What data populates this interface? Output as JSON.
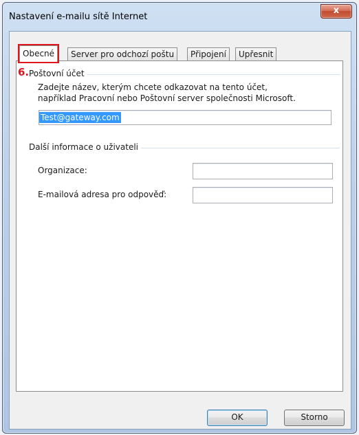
{
  "window": {
    "title": "Nastavení e-mailu sítě Internet",
    "close_glyph": "x"
  },
  "tabs": [
    {
      "label": "Obecné"
    },
    {
      "label": "Server pro odchozí poštu"
    },
    {
      "label": "Připojení"
    },
    {
      "label": "Upřesnit"
    }
  ],
  "step_marker": "6.",
  "account": {
    "group_title": "Poštovní účet",
    "description_line1": "Zadejte název, kterým chcete odkazovat na tento účet,",
    "description_line2": "například Pracovní nebo Poštovní server společnosti Microsoft.",
    "account_name_value": "Test@gateway.com"
  },
  "user_info": {
    "group_title": "Další informace o uživateli",
    "organization_label": "Organizace:",
    "organization_value": "",
    "reply_email_label": "E-mailová adresa pro odpověď:",
    "reply_email_value": ""
  },
  "buttons": {
    "ok": "OK",
    "cancel": "Storno"
  },
  "colors": {
    "highlight": "#e0161e",
    "selection": "#3399ff"
  }
}
